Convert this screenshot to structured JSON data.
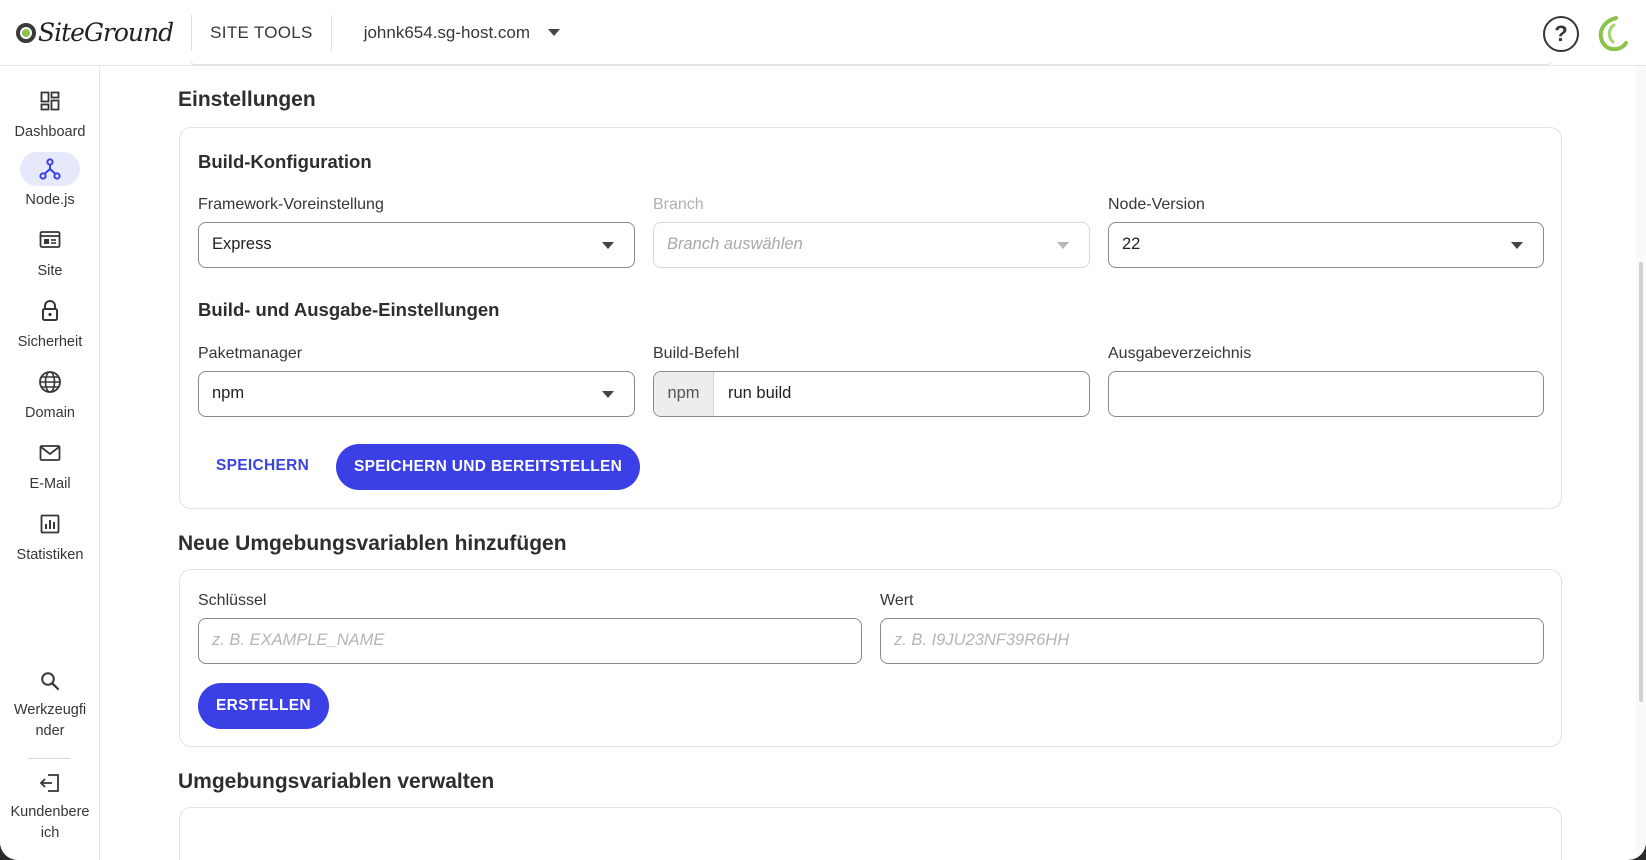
{
  "header": {
    "logo_text": "SiteGround",
    "site_tools_label": "SITE TOOLS",
    "domain": "johnk654.sg-host.com",
    "help_label": "?"
  },
  "sidebar": {
    "items": [
      {
        "label": "Dashboard",
        "icon": "dashboard-icon"
      },
      {
        "label": "Node.js",
        "icon": "nodejs-icon"
      },
      {
        "label": "Site",
        "icon": "site-icon"
      },
      {
        "label": "Sicherheit",
        "icon": "lock-icon"
      },
      {
        "label": "Domain",
        "icon": "globe-icon"
      },
      {
        "label": "E-Mail",
        "icon": "mail-icon"
      },
      {
        "label": "Statistiken",
        "icon": "stats-icon"
      }
    ],
    "bottom_items": [
      {
        "label": "Werkzeugfi nder",
        "line1": "Werkzeugfi",
        "line2": "nder",
        "icon": "search-icon"
      },
      {
        "label": "Kundenbere ich",
        "line1": "Kundenbere",
        "line2": "ich",
        "icon": "exit-icon"
      }
    ],
    "active": "Node.js",
    "accent": "#e6e9fb"
  },
  "settings": {
    "title": "Einstellungen",
    "build_config": {
      "title": "Build-Konfiguration",
      "framework_label": "Framework-Voreinstellung",
      "framework_value": "Express",
      "branch_label": "Branch",
      "branch_placeholder": "Branch auswählen",
      "node_label": "Node-Version",
      "node_value": "22"
    },
    "build_output": {
      "title": "Build- und Ausgabe-Einstellungen",
      "package_label": "Paketmanager",
      "package_value": "npm",
      "build_cmd_label": "Build-Befehl",
      "build_cmd_prefix": "npm",
      "build_cmd_value": "run build",
      "output_dir_label": "Ausgabeverzeichnis",
      "output_dir_value": ""
    },
    "save_label": "SPEICHERN",
    "save_deploy_label": "SPEICHERN UND BEREITSTELLEN"
  },
  "env_add": {
    "title": "Neue Umgebungsvariablen hinzufügen",
    "key_label": "Schlüssel",
    "key_placeholder": "z. B. EXAMPLE_NAME",
    "value_label": "Wert",
    "value_placeholder": "z. B. I9JU23NF39R6HH",
    "create_label": "ERSTELLEN"
  },
  "env_manage": {
    "title": "Umgebungsvariablen verwalten"
  },
  "colors": {
    "primary": "#3b3fe6",
    "brand_green": "#8bc34a"
  }
}
